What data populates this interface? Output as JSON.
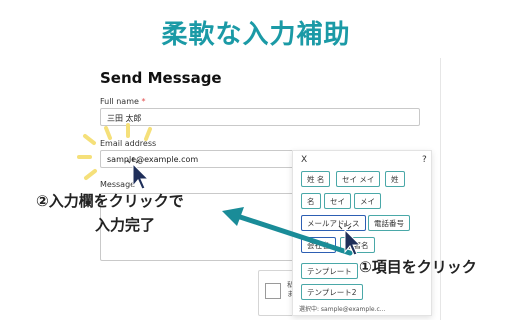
{
  "heading": "柔軟な入力補助",
  "form": {
    "title": "Send Message",
    "fullname_label": "Full name",
    "required_mark": "*",
    "fullname_value": "三田 太郎",
    "email_label": "Email address",
    "email_value": "sample@example.com",
    "message_label": "Message",
    "consent_text": "私\nま"
  },
  "popup": {
    "close": "X",
    "help": "?",
    "chips": [
      "姓 名",
      "セイ メイ",
      "姓",
      "名",
      "セイ",
      "メイ",
      "メールアドレス",
      "電話番号",
      "会社名",
      "部署名",
      "テンプレート",
      "テンプレート2"
    ],
    "footer": "選択中: sample@example.c..."
  },
  "annotations": {
    "step1": "①項目をクリック",
    "step2_line1": "②入力欄をクリックで",
    "step2_line2": "入力完了"
  },
  "colors": {
    "heading": "#1b9aa6",
    "arrow": "#1a8c98",
    "highlight": "#f5e07a",
    "chip_border": "#4aa8a8",
    "active_chip_border": "#2d5fb3"
  }
}
